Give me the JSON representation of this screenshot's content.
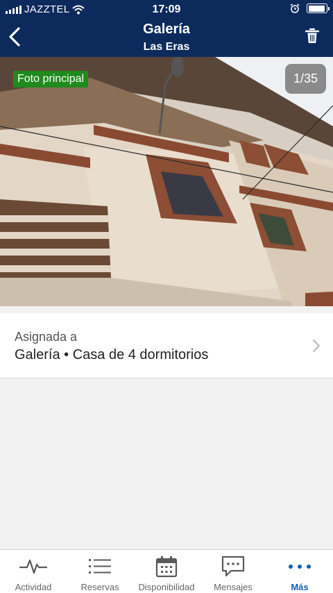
{
  "status_bar": {
    "carrier": "JAZZTEL",
    "time": "17:09",
    "battery_level": 0.95
  },
  "header": {
    "title": "Galería",
    "subtitle": "Las Eras"
  },
  "photo": {
    "badge": "Foto principal",
    "counter": "1/35",
    "current": 1,
    "total": 35
  },
  "assignment": {
    "label": "Asignada a",
    "value": "Galería • Casa de 4 dormitorios"
  },
  "tabs": [
    {
      "label": "Actividad",
      "icon": "activity-icon",
      "active": false
    },
    {
      "label": "Reservas",
      "icon": "list-icon",
      "active": false
    },
    {
      "label": "Disponibilidad",
      "icon": "calendar-icon",
      "active": false
    },
    {
      "label": "Mensajes",
      "icon": "message-icon",
      "active": false
    },
    {
      "label": "Más",
      "icon": "more-icon",
      "active": true
    }
  ],
  "colors": {
    "header_bg": "#0d2a5c",
    "badge_bg": "#1f8a1e",
    "active_tab": "#1060b8"
  }
}
